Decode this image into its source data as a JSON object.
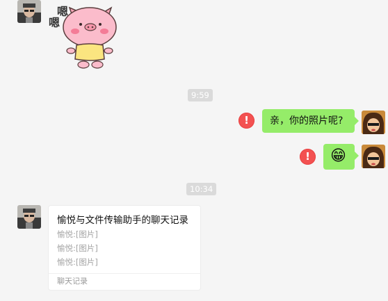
{
  "sticker": {
    "text_top": "嗯",
    "text_bottom": "嗯"
  },
  "timestamps": [
    "9:59",
    "10:34"
  ],
  "messages": {
    "outgoing_text": "亲，你的照片呢?",
    "outgoing_emoji": "😁",
    "fail_icon": "!"
  },
  "record_card": {
    "title": "愉悦与文件传输助手的聊天记录",
    "lines": [
      "愉悦:[图片]",
      "愉悦:[图片]",
      "愉悦:[图片]"
    ],
    "footer": "聊天记录"
  },
  "colors": {
    "background": "#f5f5f5",
    "bubble_green": "#95ec69",
    "fail_red": "#f35151",
    "timestamp_bg": "#dadada"
  }
}
